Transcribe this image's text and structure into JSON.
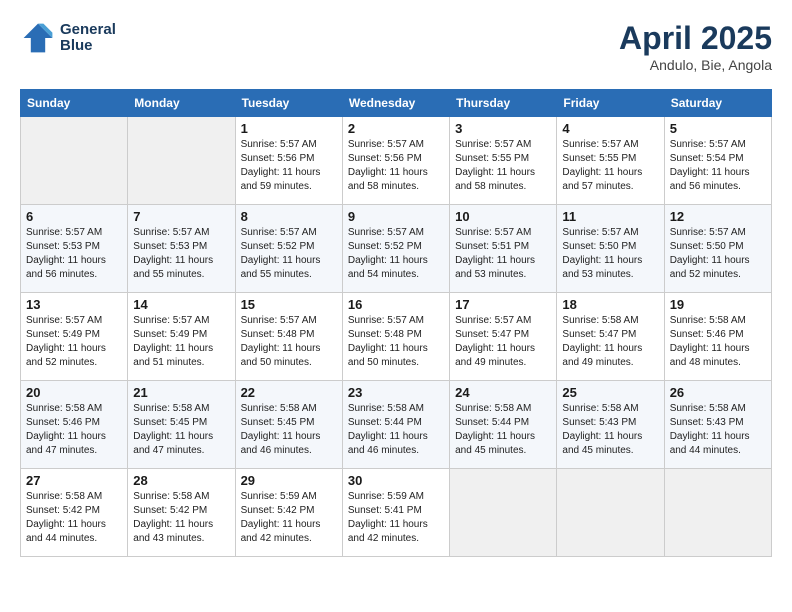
{
  "header": {
    "logo_line1": "General",
    "logo_line2": "Blue",
    "month": "April 2025",
    "location": "Andulo, Bie, Angola"
  },
  "weekdays": [
    "Sunday",
    "Monday",
    "Tuesday",
    "Wednesday",
    "Thursday",
    "Friday",
    "Saturday"
  ],
  "weeks": [
    [
      {
        "day": "",
        "info": ""
      },
      {
        "day": "",
        "info": ""
      },
      {
        "day": "1",
        "info": "Sunrise: 5:57 AM\nSunset: 5:56 PM\nDaylight: 11 hours\nand 59 minutes."
      },
      {
        "day": "2",
        "info": "Sunrise: 5:57 AM\nSunset: 5:56 PM\nDaylight: 11 hours\nand 58 minutes."
      },
      {
        "day": "3",
        "info": "Sunrise: 5:57 AM\nSunset: 5:55 PM\nDaylight: 11 hours\nand 58 minutes."
      },
      {
        "day": "4",
        "info": "Sunrise: 5:57 AM\nSunset: 5:55 PM\nDaylight: 11 hours\nand 57 minutes."
      },
      {
        "day": "5",
        "info": "Sunrise: 5:57 AM\nSunset: 5:54 PM\nDaylight: 11 hours\nand 56 minutes."
      }
    ],
    [
      {
        "day": "6",
        "info": "Sunrise: 5:57 AM\nSunset: 5:53 PM\nDaylight: 11 hours\nand 56 minutes."
      },
      {
        "day": "7",
        "info": "Sunrise: 5:57 AM\nSunset: 5:53 PM\nDaylight: 11 hours\nand 55 minutes."
      },
      {
        "day": "8",
        "info": "Sunrise: 5:57 AM\nSunset: 5:52 PM\nDaylight: 11 hours\nand 55 minutes."
      },
      {
        "day": "9",
        "info": "Sunrise: 5:57 AM\nSunset: 5:52 PM\nDaylight: 11 hours\nand 54 minutes."
      },
      {
        "day": "10",
        "info": "Sunrise: 5:57 AM\nSunset: 5:51 PM\nDaylight: 11 hours\nand 53 minutes."
      },
      {
        "day": "11",
        "info": "Sunrise: 5:57 AM\nSunset: 5:50 PM\nDaylight: 11 hours\nand 53 minutes."
      },
      {
        "day": "12",
        "info": "Sunrise: 5:57 AM\nSunset: 5:50 PM\nDaylight: 11 hours\nand 52 minutes."
      }
    ],
    [
      {
        "day": "13",
        "info": "Sunrise: 5:57 AM\nSunset: 5:49 PM\nDaylight: 11 hours\nand 52 minutes."
      },
      {
        "day": "14",
        "info": "Sunrise: 5:57 AM\nSunset: 5:49 PM\nDaylight: 11 hours\nand 51 minutes."
      },
      {
        "day": "15",
        "info": "Sunrise: 5:57 AM\nSunset: 5:48 PM\nDaylight: 11 hours\nand 50 minutes."
      },
      {
        "day": "16",
        "info": "Sunrise: 5:57 AM\nSunset: 5:48 PM\nDaylight: 11 hours\nand 50 minutes."
      },
      {
        "day": "17",
        "info": "Sunrise: 5:57 AM\nSunset: 5:47 PM\nDaylight: 11 hours\nand 49 minutes."
      },
      {
        "day": "18",
        "info": "Sunrise: 5:58 AM\nSunset: 5:47 PM\nDaylight: 11 hours\nand 49 minutes."
      },
      {
        "day": "19",
        "info": "Sunrise: 5:58 AM\nSunset: 5:46 PM\nDaylight: 11 hours\nand 48 minutes."
      }
    ],
    [
      {
        "day": "20",
        "info": "Sunrise: 5:58 AM\nSunset: 5:46 PM\nDaylight: 11 hours\nand 47 minutes."
      },
      {
        "day": "21",
        "info": "Sunrise: 5:58 AM\nSunset: 5:45 PM\nDaylight: 11 hours\nand 47 minutes."
      },
      {
        "day": "22",
        "info": "Sunrise: 5:58 AM\nSunset: 5:45 PM\nDaylight: 11 hours\nand 46 minutes."
      },
      {
        "day": "23",
        "info": "Sunrise: 5:58 AM\nSunset: 5:44 PM\nDaylight: 11 hours\nand 46 minutes."
      },
      {
        "day": "24",
        "info": "Sunrise: 5:58 AM\nSunset: 5:44 PM\nDaylight: 11 hours\nand 45 minutes."
      },
      {
        "day": "25",
        "info": "Sunrise: 5:58 AM\nSunset: 5:43 PM\nDaylight: 11 hours\nand 45 minutes."
      },
      {
        "day": "26",
        "info": "Sunrise: 5:58 AM\nSunset: 5:43 PM\nDaylight: 11 hours\nand 44 minutes."
      }
    ],
    [
      {
        "day": "27",
        "info": "Sunrise: 5:58 AM\nSunset: 5:42 PM\nDaylight: 11 hours\nand 44 minutes."
      },
      {
        "day": "28",
        "info": "Sunrise: 5:58 AM\nSunset: 5:42 PM\nDaylight: 11 hours\nand 43 minutes."
      },
      {
        "day": "29",
        "info": "Sunrise: 5:59 AM\nSunset: 5:42 PM\nDaylight: 11 hours\nand 42 minutes."
      },
      {
        "day": "30",
        "info": "Sunrise: 5:59 AM\nSunset: 5:41 PM\nDaylight: 11 hours\nand 42 minutes."
      },
      {
        "day": "",
        "info": ""
      },
      {
        "day": "",
        "info": ""
      },
      {
        "day": "",
        "info": ""
      }
    ]
  ]
}
